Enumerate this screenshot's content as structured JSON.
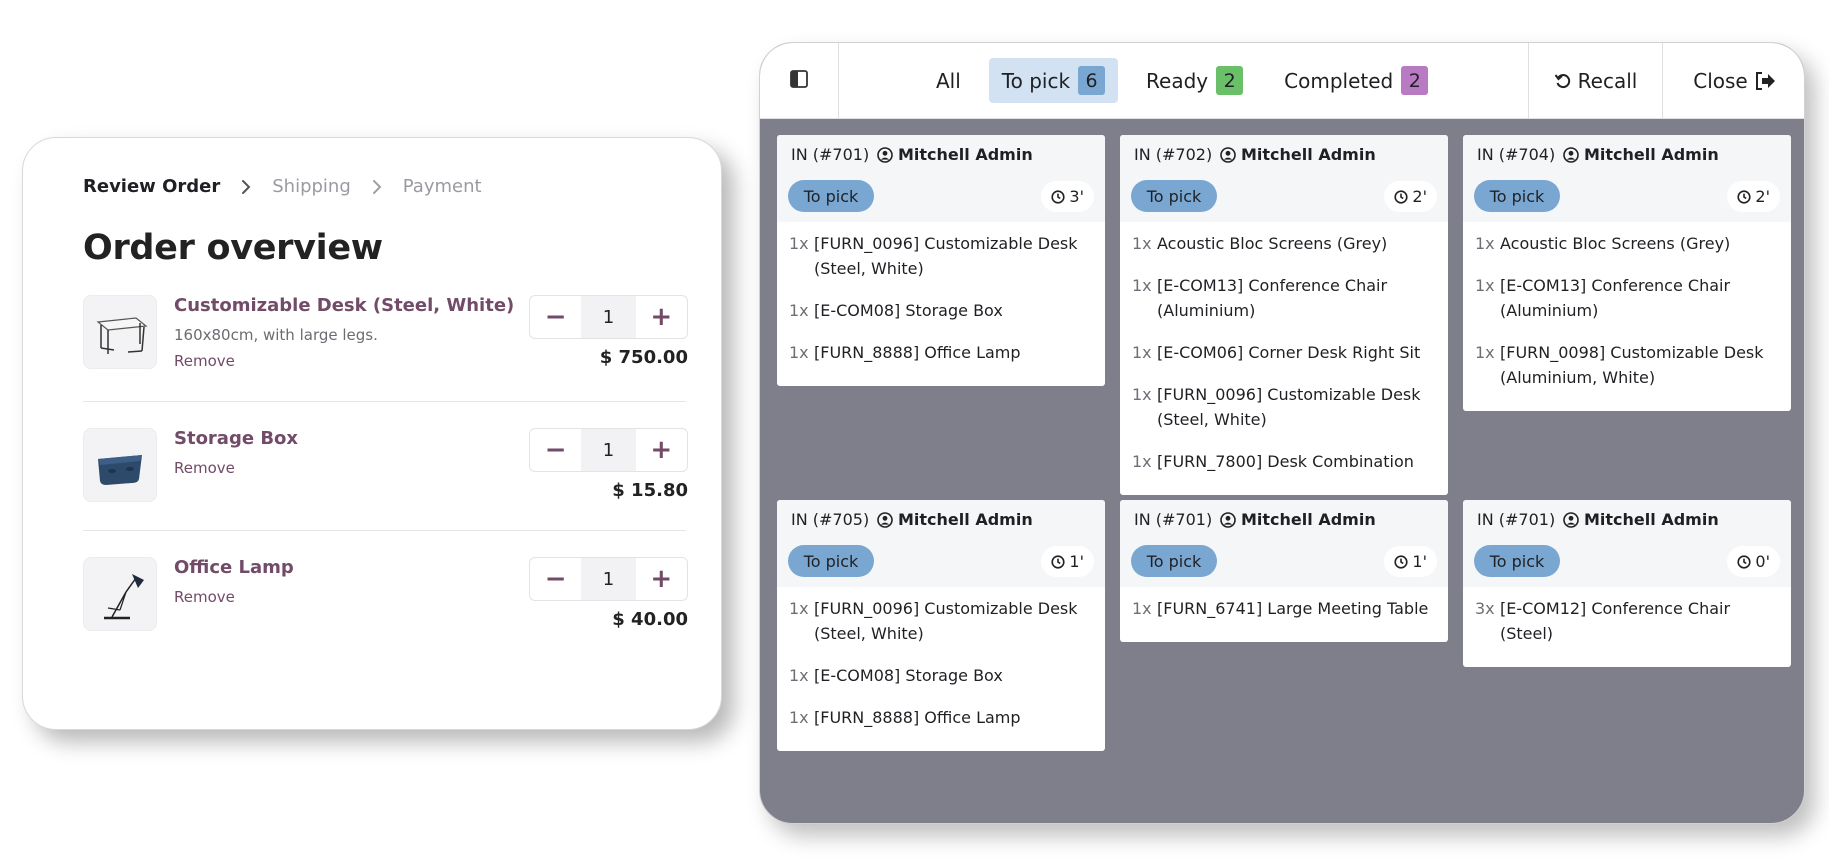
{
  "order": {
    "breadcrumb": [
      {
        "label": "Review Order",
        "active": true
      },
      {
        "label": "Shipping",
        "active": false
      },
      {
        "label": "Payment",
        "active": false
      }
    ],
    "title": "Order overview",
    "products": [
      {
        "name": "Customizable Desk (Steel, White)",
        "description": "160x80cm, with large legs.",
        "remove_label": "Remove",
        "quantity": "1",
        "price": "$ 750.00",
        "decrease_icon": "minus-icon",
        "increase_icon": "plus-icon"
      },
      {
        "name": "Storage Box",
        "description": "",
        "remove_label": "Remove",
        "quantity": "1",
        "price": "$ 15.80",
        "decrease_icon": "minus-icon",
        "increase_icon": "plus-icon"
      },
      {
        "name": "Office Lamp",
        "description": "",
        "remove_label": "Remove",
        "quantity": "1",
        "price": "$ 40.00",
        "decrease_icon": "minus-icon",
        "increase_icon": "plus-icon"
      }
    ]
  },
  "board": {
    "filters": [
      {
        "label": "All",
        "count": "",
        "active": false,
        "badge_color": ""
      },
      {
        "label": "To pick",
        "count": "6",
        "active": true,
        "badge_color": "#7aa7d1"
      },
      {
        "label": "Ready",
        "count": "2",
        "active": false,
        "badge_color": "#6abf69"
      },
      {
        "label": "Completed",
        "count": "2",
        "active": false,
        "badge_color": "#b87ac3"
      }
    ],
    "recall_label": "Recall",
    "close_label": "Close",
    "tickets": [
      {
        "ref": "IN (#701)",
        "user": "Mitchell Admin",
        "status": "To pick",
        "time": "3'",
        "lines": [
          {
            "qty": "1x",
            "name": "[FURN_0096] Customizable Desk (Steel, White)"
          },
          {
            "qty": "1x",
            "name": "[E-COM08] Storage Box"
          },
          {
            "qty": "1x",
            "name": "[FURN_8888] Office Lamp"
          }
        ]
      },
      {
        "ref": "IN (#702)",
        "user": "Mitchell Admin",
        "status": "To pick",
        "time": "2'",
        "lines": [
          {
            "qty": "1x",
            "name": "Acoustic Bloc Screens (Grey)"
          },
          {
            "qty": "1x",
            "name": "[E-COM13] Conference Chair (Aluminium)"
          },
          {
            "qty": "1x",
            "name": "[E-COM06] Corner Desk Right Sit"
          },
          {
            "qty": "1x",
            "name": "[FURN_0096] Customizable Desk (Steel, White)"
          },
          {
            "qty": "1x",
            "name": "[FURN_7800] Desk Combination"
          }
        ]
      },
      {
        "ref": "IN (#704)",
        "user": "Mitchell Admin",
        "status": "To pick",
        "time": "2'",
        "lines": [
          {
            "qty": "1x",
            "name": "Acoustic Bloc Screens (Grey)"
          },
          {
            "qty": "1x",
            "name": "[E-COM13] Conference Chair (Aluminium)"
          },
          {
            "qty": "1x",
            "name": "[FURN_0098] Customizable Desk (Aluminium, White)"
          }
        ]
      },
      {
        "ref": "IN (#705)",
        "user": "Mitchell Admin",
        "status": "To pick",
        "time": "1'",
        "lines": [
          {
            "qty": "1x",
            "name": "[FURN_0096] Customizable Desk (Steel, White)"
          },
          {
            "qty": "1x",
            "name": "[E-COM08] Storage Box"
          },
          {
            "qty": "1x",
            "name": "[FURN_8888] Office Lamp"
          }
        ]
      },
      {
        "ref": "IN (#701)",
        "user": "Mitchell Admin",
        "status": "To pick",
        "time": "1'",
        "lines": [
          {
            "qty": "1x",
            "name": "[FURN_6741] Large Meeting Table"
          }
        ]
      },
      {
        "ref": "IN (#701)",
        "user": "Mitchell Admin",
        "status": "To pick",
        "time": "0'",
        "lines": [
          {
            "qty": "3x",
            "name": "[E-COM12] Conference Chair (Steel)"
          }
        ]
      }
    ]
  },
  "colors": {
    "brand": "#714b67",
    "board_background": "#7e7f8a",
    "to_pick": "#7aa7d1",
    "ready": "#6abf69",
    "completed": "#b87ac3"
  }
}
